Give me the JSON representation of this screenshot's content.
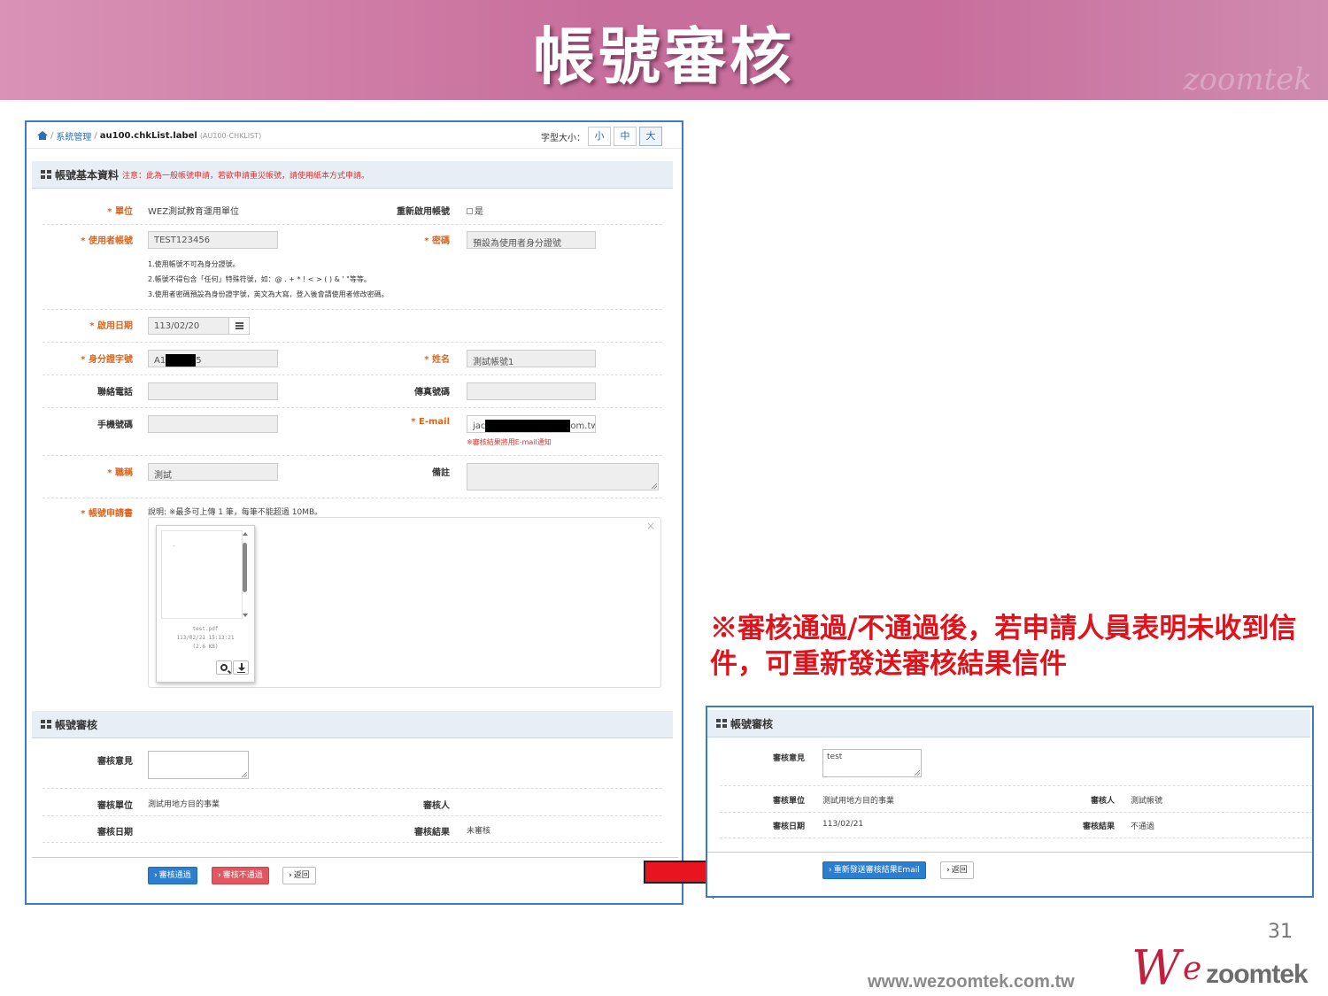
{
  "slide": {
    "title": "帳號審核",
    "watermark": "zoomtek",
    "callout": "※審核通過/不通過後，若申請人員表明未收到信件，可重新發送審核結果信件",
    "page_number": "31",
    "website": "www.wezoomtek.com.tw",
    "logo_we": "W",
    "logo_e": "e",
    "logo_zoomtek": "zoomtek"
  },
  "breadcrumb": {
    "section": "系統管理",
    "current": "au100.chkList.label",
    "code": "(AU100-CHKLIST)"
  },
  "font_size": {
    "label": "字型大小：",
    "options": [
      "小",
      "中",
      "大"
    ],
    "selected": "大"
  },
  "basic_info": {
    "header": "帳號基本資料",
    "notice": "注意：此為一般帳號申請，若欲申請重災帳號，請使用紙本方式申請。",
    "unit_label": "* 單位",
    "unit_value": "WEZ測試教育運用單位",
    "reactivate_label": "重新啟用帳號",
    "reactivate_option": "是",
    "user_account_label": "* 使用者帳號",
    "user_account_value": "TEST123456",
    "password_label": "* 密碼",
    "password_value": "預設為使用者身分證號",
    "rules": [
      "1.使用帳號不可為身分證號。",
      "2.帳號不得包含「任何」特殊符號，如：@ . + * ! < > ( ) & ' \"等等。",
      "3.使用者密碼預設為身份證字號，英文為大寫，登入後會請使用者修改密碼。"
    ],
    "start_date_label": "* 啟用日期",
    "start_date_value": "113/02/20",
    "id_label": "* 身分證字號",
    "id_prefix": "A1",
    "id_suffix": "5",
    "name_label": "* 姓名",
    "name_value": "測試帳號1",
    "phone_label": "聯絡電話",
    "fax_label": "傳真號碼",
    "mobile_label": "手機號碼",
    "email_label": "* E-mail",
    "email_prefix": "jac",
    "email_suffix": "om.tw",
    "email_note": "※審核結果將用E-mail通知",
    "title_label": "* 職稱",
    "title_value": "測試",
    "remark_label": "備註",
    "application_label": "* 帳號申請書",
    "application_desc": "說明: ※最多可上傳 1 筆，每筆不能超過 10MB。",
    "file_dash": "-",
    "file_name": "test.pdf",
    "file_time": "113/02/21 15:13:21",
    "file_size": "(2.6 KB)",
    "close_glyph": "×"
  },
  "review": {
    "header": "帳號審核",
    "opinion_label": "審核意見",
    "unit_label": "審核單位",
    "unit_value": "測試用地方目的事業",
    "reviewer_label": "審核人",
    "reviewer_value": "",
    "date_label": "審核日期",
    "date_value": "",
    "result_label": "審核結果",
    "result_value": "未審核",
    "approve_button": "審核通過",
    "reject_button": "審核不通過",
    "back_button": "返回"
  },
  "review2": {
    "header": "帳號審核",
    "opinion_label": "審核意見",
    "opinion_value": "test",
    "unit_label": "審核單位",
    "unit_value": "測試用地方目的事業",
    "reviewer_label": "審核人",
    "reviewer_value": "測試帳號",
    "date_label": "審核日期",
    "date_value": "113/02/21",
    "result_label": "審核結果",
    "result_value": "不通過",
    "resend_button": "重新發送審核結果Email",
    "back_button": "返回"
  },
  "colors": {
    "banner": "#c86e9c",
    "primary": "#2c7ed0",
    "danger": "#e2565f",
    "required": "#d9651d",
    "callout": "#e0121b",
    "arrow": "#e8141f"
  }
}
